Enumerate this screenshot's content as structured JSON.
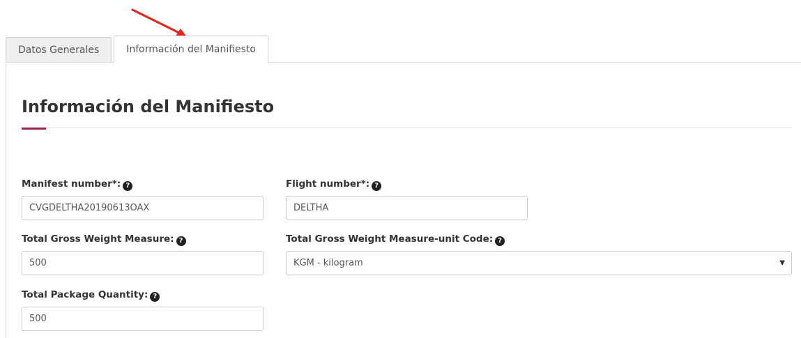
{
  "tabs": [
    {
      "label": "Datos Generales",
      "active": false
    },
    {
      "label": "Información del Manifiesto",
      "active": true
    }
  ],
  "section": {
    "title": "Información del Manifiesto",
    "accent_color": "#9d2449"
  },
  "fields": {
    "manifest_number": {
      "label": "Manifest number*:",
      "value": "CVGDELTHA20190613OAX",
      "icon": "question-circle-icon"
    },
    "flight_number": {
      "label": "Flight number*:",
      "value": "DELTHA",
      "icon": "question-circle-icon"
    },
    "total_gross_weight": {
      "label": "Total Gross Weight Measure:",
      "value": "500",
      "icon": "question-circle-icon"
    },
    "total_gross_weight_unit": {
      "label": "Total Gross Weight Measure-unit Code:",
      "value": "KGM - kilogram",
      "icon": "question-circle-icon"
    },
    "total_package_quantity": {
      "label": "Total Package Quantity:",
      "value": "500",
      "icon": "question-circle-icon"
    }
  },
  "annotation": {
    "arrow_color": "#e8211b",
    "icon": "red-arrow-annotation"
  }
}
